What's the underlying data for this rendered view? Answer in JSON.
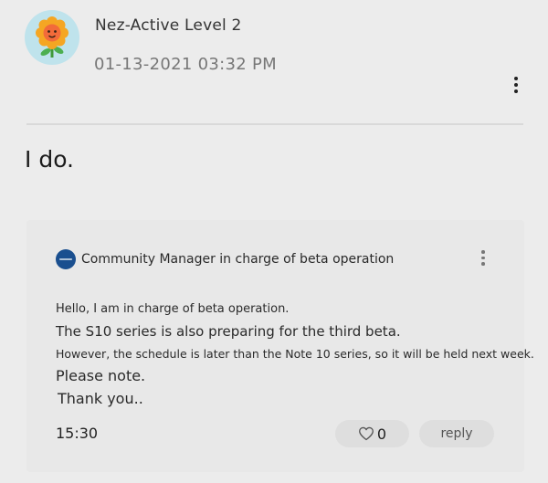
{
  "post": {
    "author": "Nez-Active Level 2",
    "timestamp": "01-13-2021 03:32 PM",
    "avatar_icon": "sunflower-avatar",
    "menu_icon": "more-vertical-icon",
    "body": "I do."
  },
  "quoted_message": {
    "author": "Community Manager in charge of beta operation",
    "logo_icon": "community-logo-icon",
    "menu_icon": "more-vertical-icon",
    "lines": [
      "Hello, I am in charge of beta operation.",
      "The S10 series is also preparing for the third beta.",
      "However, the schedule is later than the Note 10 series, so it will be held next week.",
      "Please note.",
      "Thank you.."
    ],
    "time": "15:30",
    "like_icon": "heart-icon",
    "like_count": "0",
    "reply_label": "reply"
  },
  "colors": {
    "background": "#ececec",
    "card_background": "#e8e8e8",
    "button_background": "#dedede",
    "logo_blue": "#1a4f8f",
    "avatar_bg": "#bfe3ec"
  }
}
